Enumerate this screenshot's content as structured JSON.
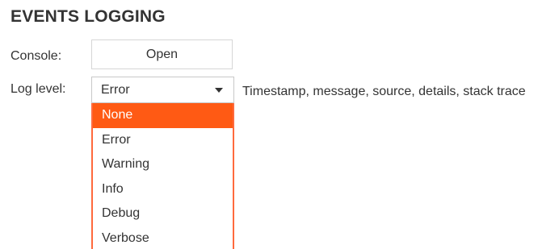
{
  "section": {
    "title": "EVENTS LOGGING"
  },
  "console": {
    "label": "Console:",
    "button_label": "Open"
  },
  "log_level": {
    "label": "Log level:",
    "selected_value": "Error",
    "description": "Timestamp, message, source, details, stack trace",
    "options": [
      {
        "label": "None",
        "highlighted": true
      },
      {
        "label": "Error",
        "highlighted": false
      },
      {
        "label": "Warning",
        "highlighted": false
      },
      {
        "label": "Info",
        "highlighted": false
      },
      {
        "label": "Debug",
        "highlighted": false
      },
      {
        "label": "Verbose",
        "highlighted": false
      }
    ]
  },
  "colors": {
    "highlight_background": "#ff5a14",
    "dropdown_border": "#ff6a3d",
    "text": "#333333"
  },
  "icons": {
    "select_caret": "caret-down-icon"
  }
}
